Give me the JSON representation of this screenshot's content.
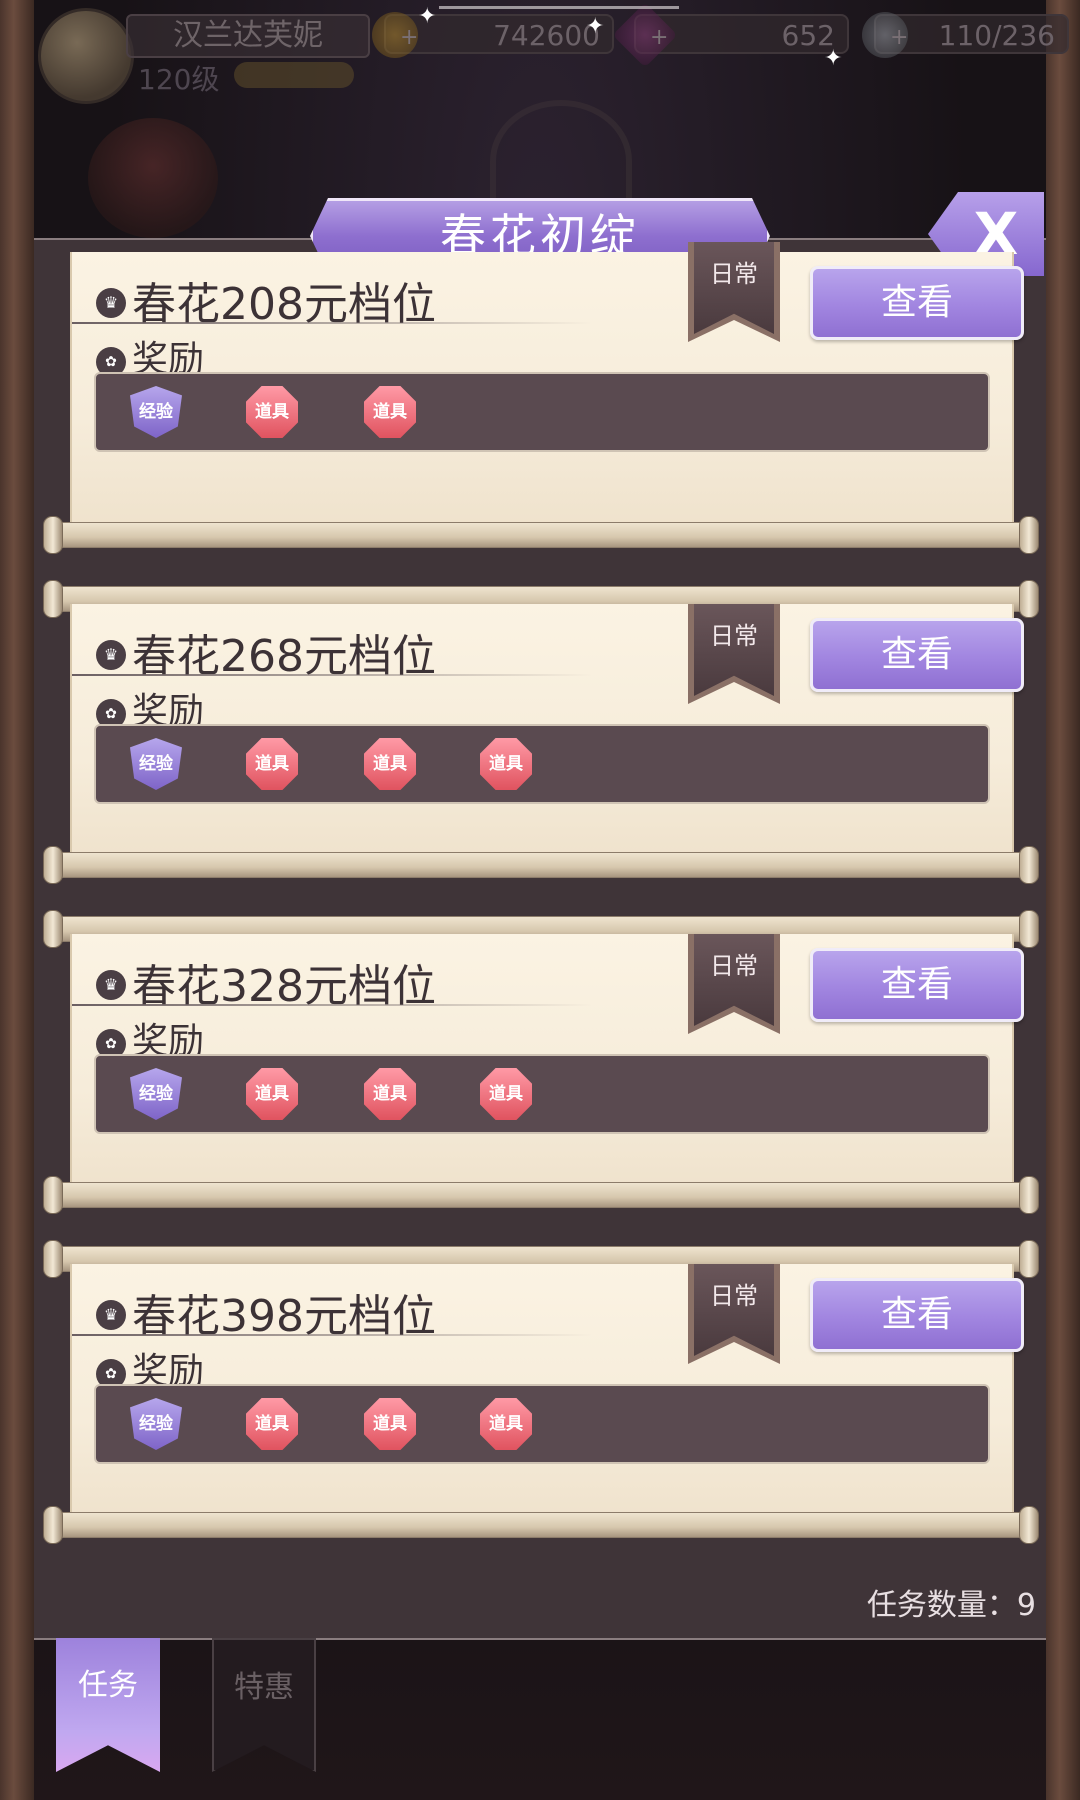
{
  "header": {
    "player_name": "汉兰达芙妮",
    "level": "120级",
    "gold": "742600",
    "gems": "652",
    "energy": "110/236"
  },
  "panel": {
    "title": "春花初绽",
    "close_label": "X"
  },
  "cards": [
    {
      "title": "春花208元档位",
      "reward_label": "奖励",
      "tag": "日常",
      "button": "查看",
      "rewards": [
        "经验",
        "道具",
        "道具"
      ]
    },
    {
      "title": "春花268元档位",
      "reward_label": "奖励",
      "tag": "日常",
      "button": "查看",
      "rewards": [
        "经验",
        "道具",
        "道具",
        "道具"
      ]
    },
    {
      "title": "春花328元档位",
      "reward_label": "奖励",
      "tag": "日常",
      "button": "查看",
      "rewards": [
        "经验",
        "道具",
        "道具",
        "道具"
      ]
    },
    {
      "title": "春花398元档位",
      "reward_label": "奖励",
      "tag": "日常",
      "button": "查看",
      "rewards": [
        "经验",
        "道具",
        "道具",
        "道具"
      ]
    }
  ],
  "footer": {
    "task_count": "任务数量：9"
  },
  "tabs": [
    {
      "label": "任务",
      "active": true
    },
    {
      "label": "特惠",
      "active": false
    }
  ],
  "colors": {
    "accent_purple": "#9b80dc",
    "reward_prop": "#e85a66",
    "reward_exp": "#8e72d0"
  }
}
